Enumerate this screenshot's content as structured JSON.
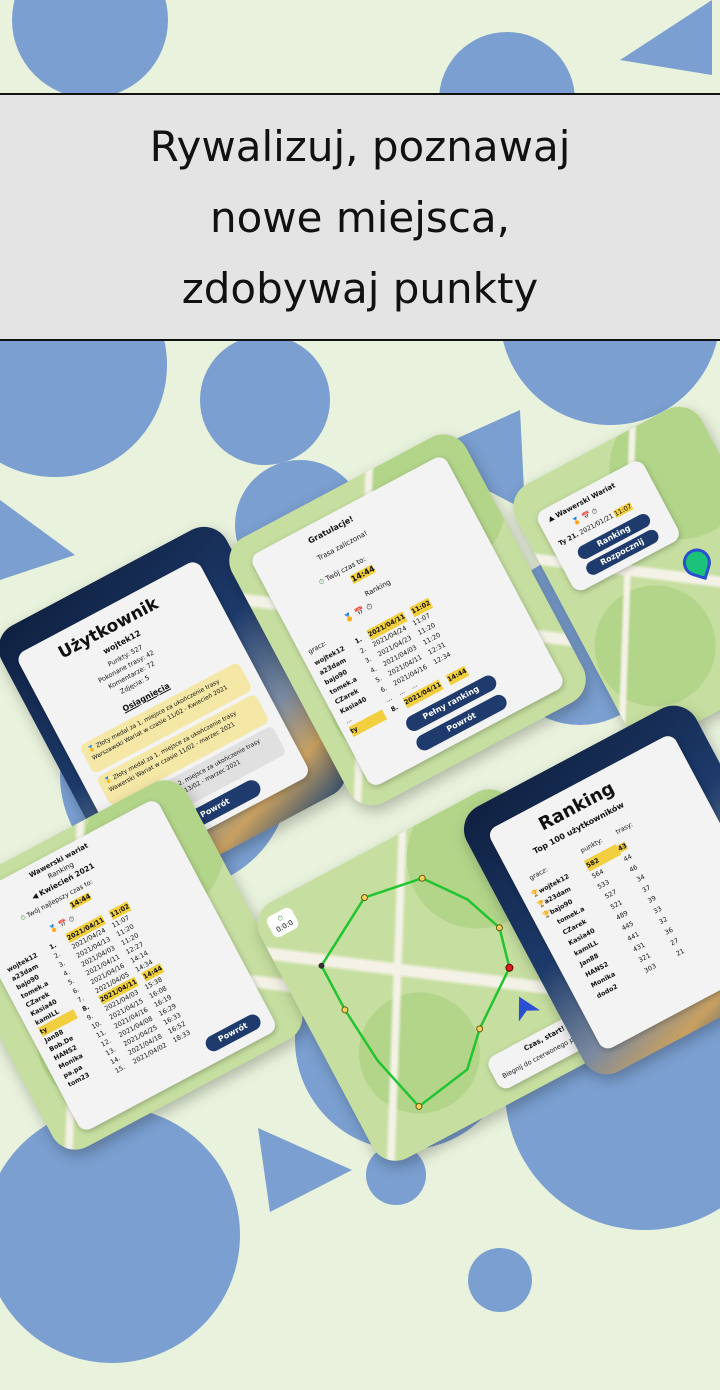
{
  "headline": {
    "line1": "Rywalizuj, poznawaj",
    "line2": "nowe miejsca,",
    "line3": "zdobywaj punkty"
  },
  "colors": {
    "background": "#e8f2dc",
    "shape": "#7a9fd0",
    "banner": "#e4e4e4",
    "button": "#1f3b6e",
    "highlight": "#f2cf3e"
  },
  "profile_screen": {
    "title": "Użytkownik",
    "username": "wojtek12",
    "stats": [
      "Punkty: 527",
      "Pokonane trasy: 42",
      "Komentarze: 72",
      "Zdjęcia: 5"
    ],
    "achievements_title": "Osiągnięcia",
    "achievements": [
      "Złoty medal za 1. miejsce za ukończenie trasy Warszawski Wariat w czasie 11/02 - Kwiecień 2021",
      "Złoty medal za 1. miejsce za ukończenie trasy Wawerski Wariat w czasie 11/02 - marzec 2021",
      "Srebrny medal za 2. miejsce za ukończenie trasy Szybki Szlak w czasie 13/02 - marzec 2021"
    ],
    "back_button": "Powrót"
  },
  "congrats_screen": {
    "title": "Gratulacje!",
    "subtitle": "Trasa zaliczona!",
    "your_time_label": "Twój czas to:",
    "your_time": "14:44",
    "ranking_label": "Ranking",
    "header": [
      "gracz:"
    ],
    "rows": [
      {
        "name": "wojtek12",
        "pos": "1.",
        "date": "2021/04/11",
        "time": "11:02"
      },
      {
        "name": "a23dam",
        "pos": "2.",
        "date": "2021/04/24",
        "time": "11:07"
      },
      {
        "name": "bajo90",
        "pos": "3.",
        "date": "2021/04/23",
        "time": "11:20"
      },
      {
        "name": "tomek.a",
        "pos": "4.",
        "date": "2021/04/03",
        "time": "11:20"
      },
      {
        "name": "CZarek",
        "pos": "5.",
        "date": "2021/04/11",
        "time": "12:31"
      },
      {
        "name": "Kasia40",
        "pos": "6.",
        "date": "2021/04/16",
        "time": "12:34"
      },
      {
        "name": "...",
        "pos": "...",
        "date": "...",
        "time": "..."
      },
      {
        "name": "ty",
        "pos": "8.",
        "date": "2021/04/11",
        "time": "14:44"
      }
    ],
    "full_ranking_button": "Pełny ranking",
    "back_button": "Powrót"
  },
  "route_screen": {
    "route_name": "Wawerski Wariat",
    "row": {
      "pos": "21.",
      "date": "2021/01/21",
      "time": "11:07",
      "you": "Ty"
    },
    "ranking_button": "Ranking",
    "start_button": "Rozpocznij"
  },
  "month_ranking_screen": {
    "route_name": "Wawerski wariat",
    "ranking_label": "Ranking",
    "month": "Kwiecień 2021",
    "best_time_label": "Twój najlepszy czas to:",
    "best_time": "14:44",
    "rows": [
      {
        "name": "wojtek12",
        "pos": "1.",
        "date": "2021/04/11",
        "time": "11:02"
      },
      {
        "name": "a23dam",
        "pos": "2.",
        "date": "2021/04/24",
        "time": "11:07"
      },
      {
        "name": "bajo90",
        "pos": "3.",
        "date": "2021/04/13",
        "time": "11:20"
      },
      {
        "name": "tomek.a",
        "pos": "4.",
        "date": "2021/04/03",
        "time": "11:20"
      },
      {
        "name": "CZarek",
        "pos": "5.",
        "date": "2021/04/11",
        "time": "12:27"
      },
      {
        "name": "Kasia40",
        "pos": "6.",
        "date": "2021/04/16",
        "time": "14:14"
      },
      {
        "name": "kamILL",
        "pos": "7.",
        "date": "2021/04/05",
        "time": "14:34"
      },
      {
        "name": "ty",
        "pos": "8.",
        "date": "2021/04/11",
        "time": "14:44"
      },
      {
        "name": "Jan88",
        "pos": "9.",
        "date": "2021/04/03",
        "time": "15:38"
      },
      {
        "name": "Bob.De",
        "pos": "10.",
        "date": "2021/04/15",
        "time": "16:08"
      },
      {
        "name": "HANS2",
        "pos": "11.",
        "date": "2021/04/16",
        "time": "16:19"
      },
      {
        "name": "Monika",
        "pos": "12.",
        "date": "2021/04/08",
        "time": "16:29"
      },
      {
        "name": "pa.pa",
        "pos": "13.",
        "date": "2021/04/25",
        "time": "16:33"
      },
      {
        "name": "tom23",
        "pos": "14.",
        "date": "2021/04/18",
        "time": "16:52"
      },
      {
        "name": "",
        "pos": "15.",
        "date": "2021/04/02",
        "time": "18:33"
      }
    ],
    "back_button": "Powrót"
  },
  "map_screen": {
    "timer": "0:0:0",
    "popup_title": "Czas, start!",
    "popup_text": "Biegnij do czerwonego punktu!"
  },
  "top_ranking_screen": {
    "title": "Ranking",
    "subtitle": "Top 100 użytkowników",
    "headers": [
      "gracz:",
      "punkty:",
      "trasy:"
    ],
    "rows": [
      {
        "name": "wojtek12",
        "points": "582",
        "routes": "43"
      },
      {
        "name": "a23dam",
        "points": "564",
        "routes": "44"
      },
      {
        "name": "bajo90",
        "points": "533",
        "routes": "46"
      },
      {
        "name": "tomek.a",
        "points": "527",
        "routes": "34"
      },
      {
        "name": "CZarek",
        "points": "521",
        "routes": "37"
      },
      {
        "name": "Kasia40",
        "points": "489",
        "routes": "39"
      },
      {
        "name": "kamILL",
        "points": "445",
        "routes": "33"
      },
      {
        "name": "Jan88",
        "points": "441",
        "routes": "32"
      },
      {
        "name": "HANS2",
        "points": "431",
        "routes": "36"
      },
      {
        "name": "Monika",
        "points": "321",
        "routes": "27"
      },
      {
        "name": "dodo2",
        "points": "303",
        "routes": "21"
      }
    ]
  }
}
